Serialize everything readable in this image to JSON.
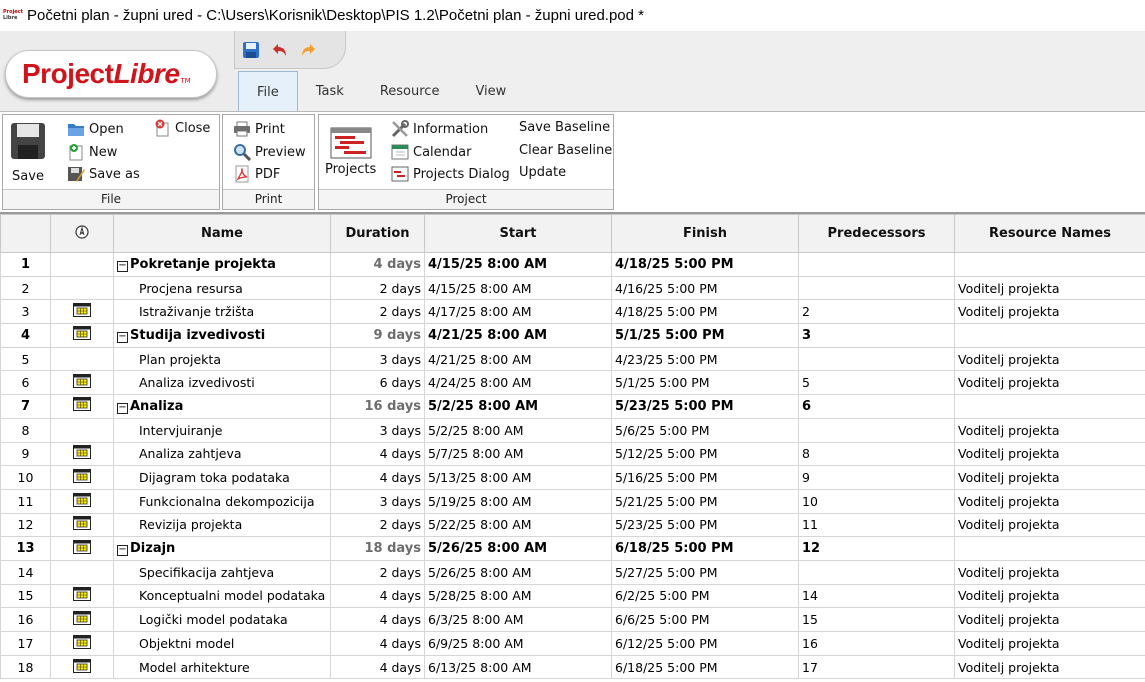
{
  "window": {
    "title": "Početni plan - župni ured - C:\\Users\\Korisnik\\Desktop\\PIS 1.2\\Početni plan - župni ured.pod *",
    "app_icon_text": [
      "Project",
      "Libre"
    ]
  },
  "logo": {
    "part1": "Project",
    "part2": "Libre",
    "tm": "TM"
  },
  "quick_access": {
    "save": "save-icon",
    "undo": "undo-icon",
    "redo": "redo-icon"
  },
  "tabs": [
    {
      "label": "File",
      "active": true
    },
    {
      "label": "Task",
      "active": false
    },
    {
      "label": "Resource",
      "active": false
    },
    {
      "label": "View",
      "active": false
    }
  ],
  "ribbon": {
    "file_group": {
      "label": "File",
      "save": "Save",
      "open": "Open",
      "new": "New",
      "save_as": "Save as",
      "close": "Close"
    },
    "print_group": {
      "label": "Print",
      "print": "Print",
      "preview": "Preview",
      "pdf": "PDF"
    },
    "project_group": {
      "label": "Project",
      "projects": "Projects",
      "information": "Information",
      "calendar": "Calendar",
      "projects_dialog": "Projects Dialog",
      "save_baseline": "Save Baseline",
      "clear_baseline": "Clear Baseline",
      "update": "Update"
    }
  },
  "grid": {
    "headers": {
      "indicator": "info-icon",
      "name": "Name",
      "duration": "Duration",
      "start": "Start",
      "finish": "Finish",
      "predecessors": "Predecessors",
      "resources": "Resource Names"
    },
    "rows": [
      {
        "id": "1",
        "summary": true,
        "calendar": false,
        "name": "Pokretanje projekta",
        "duration": "4 days",
        "start": "4/15/25 8:00 AM",
        "finish": "4/18/25 5:00 PM",
        "pred": "",
        "res": ""
      },
      {
        "id": "2",
        "summary": false,
        "calendar": false,
        "name": "Procjena resursa",
        "duration": "2 days",
        "start": "4/15/25 8:00 AM",
        "finish": "4/16/25 5:00 PM",
        "pred": "",
        "res": "Voditelj projekta"
      },
      {
        "id": "3",
        "summary": false,
        "calendar": true,
        "name": "Istraživanje tržišta",
        "duration": "2 days",
        "start": "4/17/25 8:00 AM",
        "finish": "4/18/25 5:00 PM",
        "pred": "2",
        "res": "Voditelj projekta"
      },
      {
        "id": "4",
        "summary": true,
        "calendar": true,
        "name": "Studija izvedivosti",
        "duration": "9 days",
        "start": "4/21/25 8:00 AM",
        "finish": "5/1/25 5:00 PM",
        "pred": "3",
        "res": ""
      },
      {
        "id": "5",
        "summary": false,
        "calendar": false,
        "name": "Plan projekta",
        "duration": "3 days",
        "start": "4/21/25 8:00 AM",
        "finish": "4/23/25 5:00 PM",
        "pred": "",
        "res": "Voditelj projekta"
      },
      {
        "id": "6",
        "summary": false,
        "calendar": true,
        "name": "Analiza izvedivosti",
        "duration": "6 days",
        "start": "4/24/25 8:00 AM",
        "finish": "5/1/25 5:00 PM",
        "pred": "5",
        "res": "Voditelj projekta"
      },
      {
        "id": "7",
        "summary": true,
        "calendar": true,
        "name": "Analiza",
        "duration": "16 days",
        "start": "5/2/25 8:00 AM",
        "finish": "5/23/25 5:00 PM",
        "pred": "6",
        "res": ""
      },
      {
        "id": "8",
        "summary": false,
        "calendar": false,
        "name": "Intervjuiranje",
        "duration": "3 days",
        "start": "5/2/25 8:00 AM",
        "finish": "5/6/25 5:00 PM",
        "pred": "",
        "res": "Voditelj projekta"
      },
      {
        "id": "9",
        "summary": false,
        "calendar": true,
        "name": "Analiza zahtjeva",
        "duration": "4 days",
        "start": "5/7/25 8:00 AM",
        "finish": "5/12/25 5:00 PM",
        "pred": "8",
        "res": "Voditelj projekta"
      },
      {
        "id": "10",
        "summary": false,
        "calendar": true,
        "name": "Dijagram toka podataka",
        "duration": "4 days",
        "start": "5/13/25 8:00 AM",
        "finish": "5/16/25 5:00 PM",
        "pred": "9",
        "res": "Voditelj projekta"
      },
      {
        "id": "11",
        "summary": false,
        "calendar": true,
        "name": "Funkcionalna dekompozicija",
        "duration": "3 days",
        "start": "5/19/25 8:00 AM",
        "finish": "5/21/25 5:00 PM",
        "pred": "10",
        "res": "Voditelj projekta"
      },
      {
        "id": "12",
        "summary": false,
        "calendar": true,
        "name": "Revizija projekta",
        "duration": "2 days",
        "start": "5/22/25 8:00 AM",
        "finish": "5/23/25 5:00 PM",
        "pred": "11",
        "res": "Voditelj projekta"
      },
      {
        "id": "13",
        "summary": true,
        "calendar": true,
        "name": "Dizajn",
        "duration": "18 days",
        "start": "5/26/25 8:00 AM",
        "finish": "6/18/25 5:00 PM",
        "pred": "12",
        "res": ""
      },
      {
        "id": "14",
        "summary": false,
        "calendar": false,
        "name": "Specifikacija zahtjeva",
        "duration": "2 days",
        "start": "5/26/25 8:00 AM",
        "finish": "5/27/25 5:00 PM",
        "pred": "",
        "res": "Voditelj projekta"
      },
      {
        "id": "15",
        "summary": false,
        "calendar": true,
        "name": "Konceptualni model podataka",
        "duration": "4 days",
        "start": "5/28/25 8:00 AM",
        "finish": "6/2/25 5:00 PM",
        "pred": "14",
        "res": "Voditelj projekta"
      },
      {
        "id": "16",
        "summary": false,
        "calendar": true,
        "name": "Logički model podataka",
        "duration": "4 days",
        "start": "6/3/25 8:00 AM",
        "finish": "6/6/25 5:00 PM",
        "pred": "15",
        "res": "Voditelj projekta"
      },
      {
        "id": "17",
        "summary": false,
        "calendar": true,
        "name": "Objektni model",
        "duration": "4 days",
        "start": "6/9/25 8:00 AM",
        "finish": "6/12/25 5:00 PM",
        "pred": "16",
        "res": "Voditelj projekta"
      },
      {
        "id": "18",
        "summary": false,
        "calendar": true,
        "name": "Model arhitekture",
        "duration": "4 days",
        "start": "6/13/25 8:00 AM",
        "finish": "6/18/25 5:00 PM",
        "pred": "17",
        "res": "Voditelj projekta"
      }
    ]
  }
}
